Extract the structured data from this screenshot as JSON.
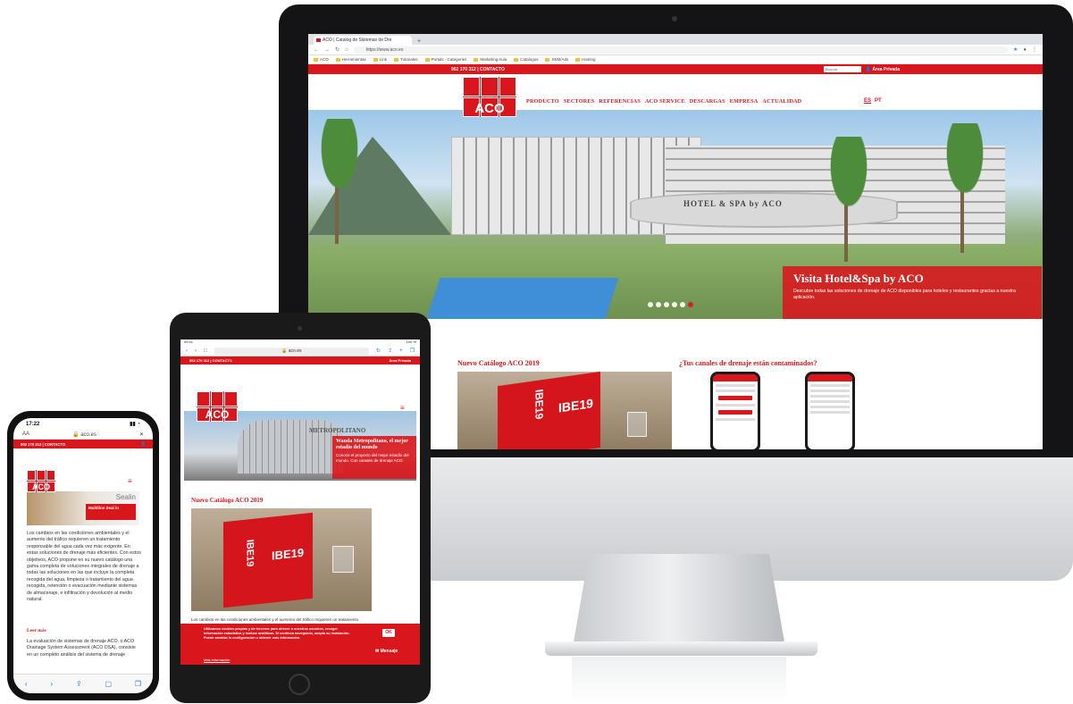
{
  "desktop": {
    "tab_title": "ACO | Catalog de Sistemas de Dre",
    "url": "https://www.aco.es",
    "bookmarks": [
      "ACO",
      "Herramientas",
      "Link",
      "Tutoriales",
      "Portals - Categories",
      "Marketing Aula",
      "Catalogos",
      "SEM/Ads",
      "Hosting"
    ],
    "contact": "902 170 312 | CONTACTO",
    "search_placeholder": "Buscar",
    "private_area": "Área Privada",
    "logo": "ACO",
    "nav": [
      "PRODUCTO",
      "SECTORES",
      "REFERENCIAS",
      "ACO SERVICE",
      "DESCARGAS",
      "EMPRESA",
      "ACTUALIDAD"
    ],
    "languages": [
      "ES",
      "PT"
    ],
    "hero": {
      "title": "Visita Hotel&Spa by ACO",
      "text": "Descubre todas las soluciones de drenaje de ACO disponibles para hoteles y restaurantes gracias a nuestra aplicación.",
      "building_sign": "HOTEL & SPA by ACO",
      "slides": 6,
      "active_slide": 6
    },
    "catalog_title": "Nuevo Catálogo ACO 2019",
    "book_label": "IBE19",
    "drains_title": "¿Tus canales de drenaje están contaminados?"
  },
  "tablet": {
    "status_time": "09:41",
    "status_battery": "100 %",
    "url": "aco.es",
    "contact": "902 170 312 | CONTACTO",
    "private_area": "Área Privada",
    "logo": "ACO",
    "stadium_sign": "METROPOLITANO",
    "hero_title": "Wanda Metropolitano, el mejor estadio del mundo",
    "hero_text": "Conoce el proyecto del mejor estadio del mundo. Con canales de drenaje ACO.",
    "catalog_title": "Nuevo Catálogo ACO 2019",
    "book_label": "IBE19",
    "body_line": "Los cambios en las condiciones ambientales y el aumento del tráfico requieren un tratamiento",
    "cookie_text": "Utilizamos cookies propias y de terceros para ofrecer a nuestros usuarios, recoger información estadística y realizar analíticas. Si continúa navegando, acepta su instalación. Puede cambiar la configuración u obtener más información.",
    "cookie_link": "Más información",
    "ok_label": "OK",
    "message_label": "Mensaje"
  },
  "phone": {
    "status_time": "17:22",
    "url": "aco.es",
    "contact": "902 170 312 | CONTACTO",
    "logo": "ACO",
    "product_name": "Sealin",
    "card_title": "Multiline Seal in",
    "body": "Los cambios en las condiciones ambientales y el aumento del tráfico requieren un tratamiento responsable del agua cada vez más exigente. En estas soluciones de drenaje más eficientes. Con estos objetivos, ACO propone en su nuevo catálogo una gama completa de soluciones integrales de drenaje a todas las soluciones en las que incluye la completa recogida del agua, limpieza o tratamiento del agua recogida, retención o evacuación mediante sistemas de almacenaje, e infiltración y devolución al medio natural.",
    "read_more": "Leer más",
    "body2": "La evaluación de sistemas de drenaje ACO, o ACO Drainage System Assessment (ACO DSA), consiste en un completo análisis del sistema de drenaje"
  }
}
